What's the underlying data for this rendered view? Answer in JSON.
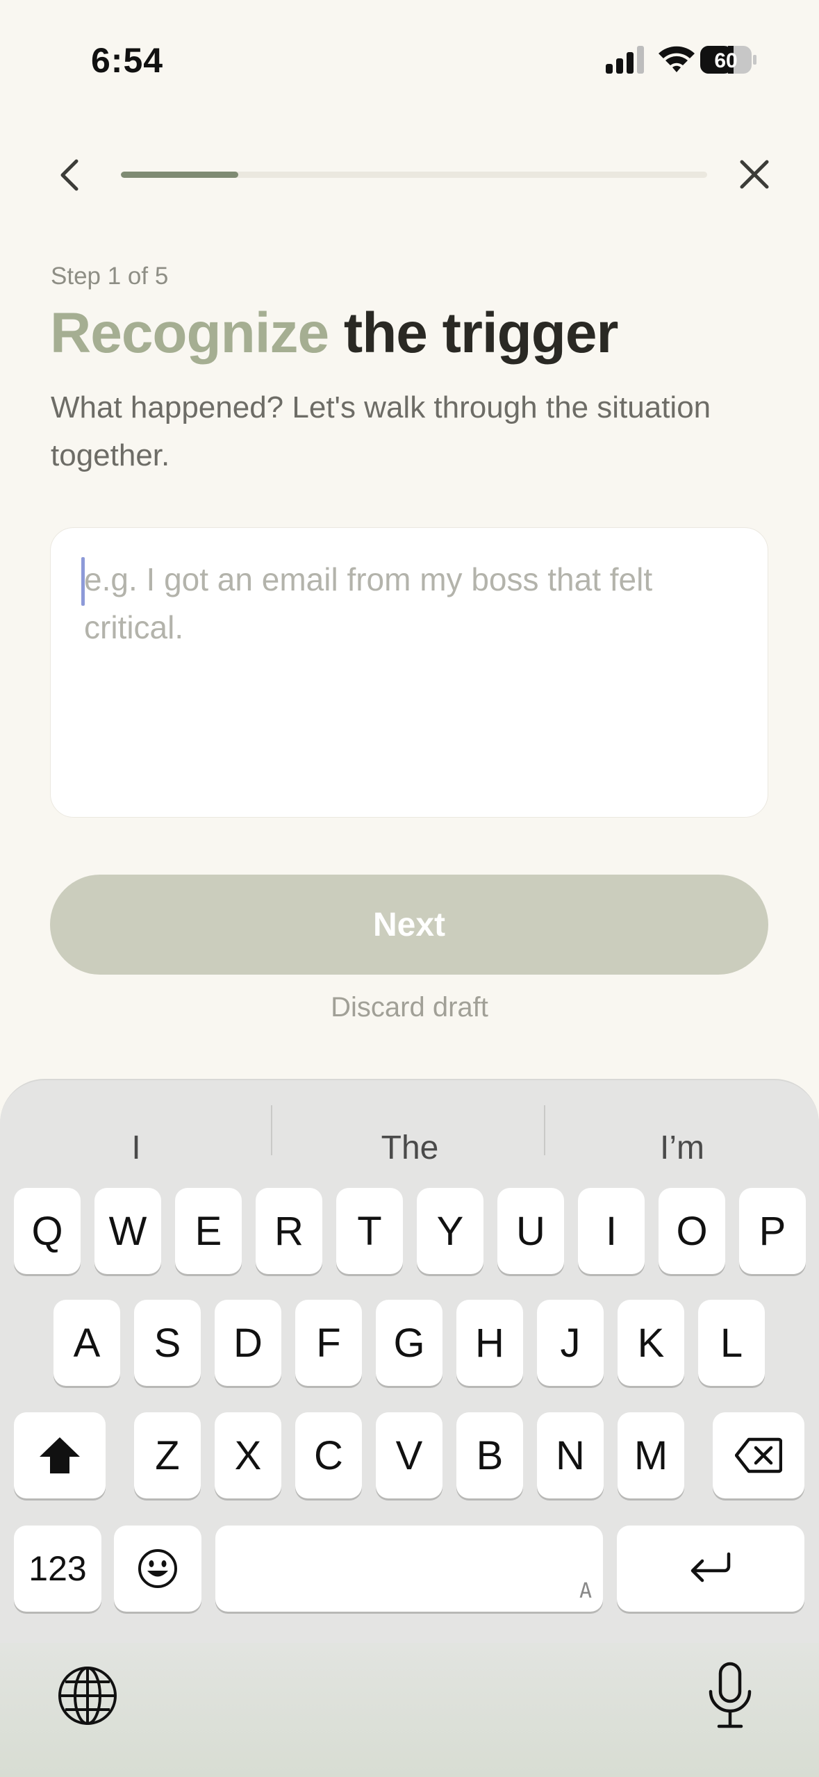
{
  "status_bar": {
    "time": "6:54",
    "battery": "60"
  },
  "nav": {
    "progress_fraction": 0.2
  },
  "content": {
    "step_label": "Step 1 of 5",
    "title_accent": "Recognize",
    "title_rest": "the trigger",
    "subtitle": "What happened? Let's walk through the situation together.",
    "input_placeholder": "e.g. I got an email from my boss that felt critical.",
    "next_label": "Next",
    "discard_label": "Discard draft"
  },
  "keyboard": {
    "suggestions": [
      "I",
      "The",
      "I’m"
    ],
    "row1": [
      "Q",
      "W",
      "E",
      "R",
      "T",
      "Y",
      "U",
      "I",
      "O",
      "P"
    ],
    "row2": [
      "A",
      "S",
      "D",
      "F",
      "G",
      "H",
      "J",
      "K",
      "L"
    ],
    "row3": [
      "Z",
      "X",
      "C",
      "V",
      "B",
      "N",
      "M"
    ],
    "numbers_label": "123",
    "space_corner": "A"
  },
  "colors": {
    "accent_green": "#a5ae92",
    "progress_fill": "#7f8b73",
    "button_disabled": "#cbcdbd",
    "caret": "#8d9ad8"
  }
}
